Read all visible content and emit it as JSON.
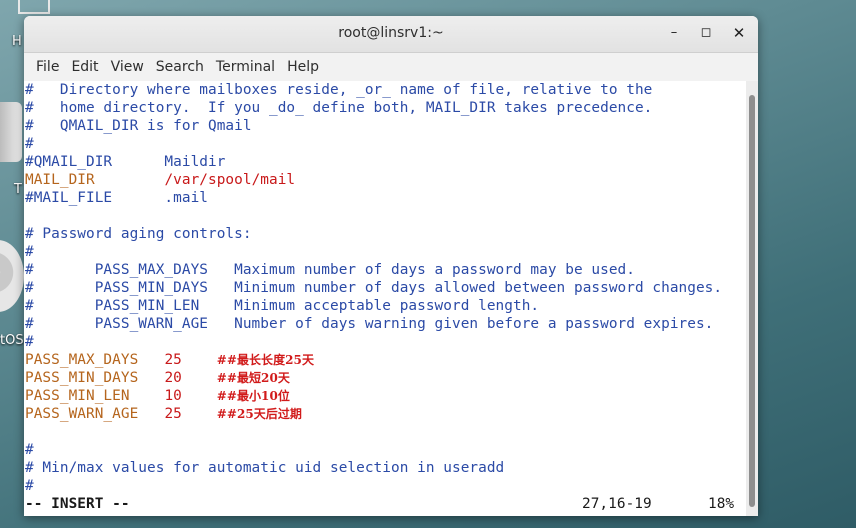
{
  "desktop": {
    "frag_top": "H",
    "frag_mid": "T",
    "frag_os": "tOS"
  },
  "window": {
    "title": "root@linsrv1:~",
    "buttons": {
      "minimize": "–",
      "maximize": "◻",
      "close": "✕"
    }
  },
  "menu": [
    "File",
    "Edit",
    "View",
    "Search",
    "Terminal",
    "Help"
  ],
  "lines": [
    "#   Directory where mailboxes reside, _or_ name of file, relative to the",
    "#   home directory.  If you _do_ define both, MAIL_DIR takes precedence.",
    "#   QMAIL_DIR is for Qmail",
    "#",
    "#QMAIL_DIR      Maildir",
    "MAIL_DIR",
    "/var/spool/mail",
    "#MAIL_FILE      .mail",
    "",
    "# Password aging controls:",
    "#",
    "#       PASS_MAX_DAYS   Maximum number of days a password may be used.",
    "#       PASS_MIN_DAYS   Minimum number of days allowed between password changes.",
    "#       PASS_MIN_LEN    Minimum acceptable password length.",
    "#       PASS_WARN_AGE   Number of days warning given before a password expires.",
    "#"
  ],
  "settings": [
    {
      "key": "PASS_MAX_DAYS",
      "value": "25",
      "note": "##最长长度25天"
    },
    {
      "key": "PASS_MIN_DAYS",
      "value": "20",
      "note": "##最短20天"
    },
    {
      "key": "PASS_MIN_LEN",
      "value": "10",
      "note": "##最小10位"
    },
    {
      "key": "PASS_WARN_AGE",
      "value": "25",
      "note": "##25天后过期"
    }
  ],
  "tail": [
    "",
    "#",
    "# Min/max values for automatic uid selection in useradd",
    "#"
  ],
  "status": {
    "mode": "-- INSERT --",
    "position": "27,16-19",
    "percent": "18%"
  },
  "colors": {
    "comment": "#2b4aa6",
    "keyword": "#b5651d",
    "value": "#c8191a"
  }
}
